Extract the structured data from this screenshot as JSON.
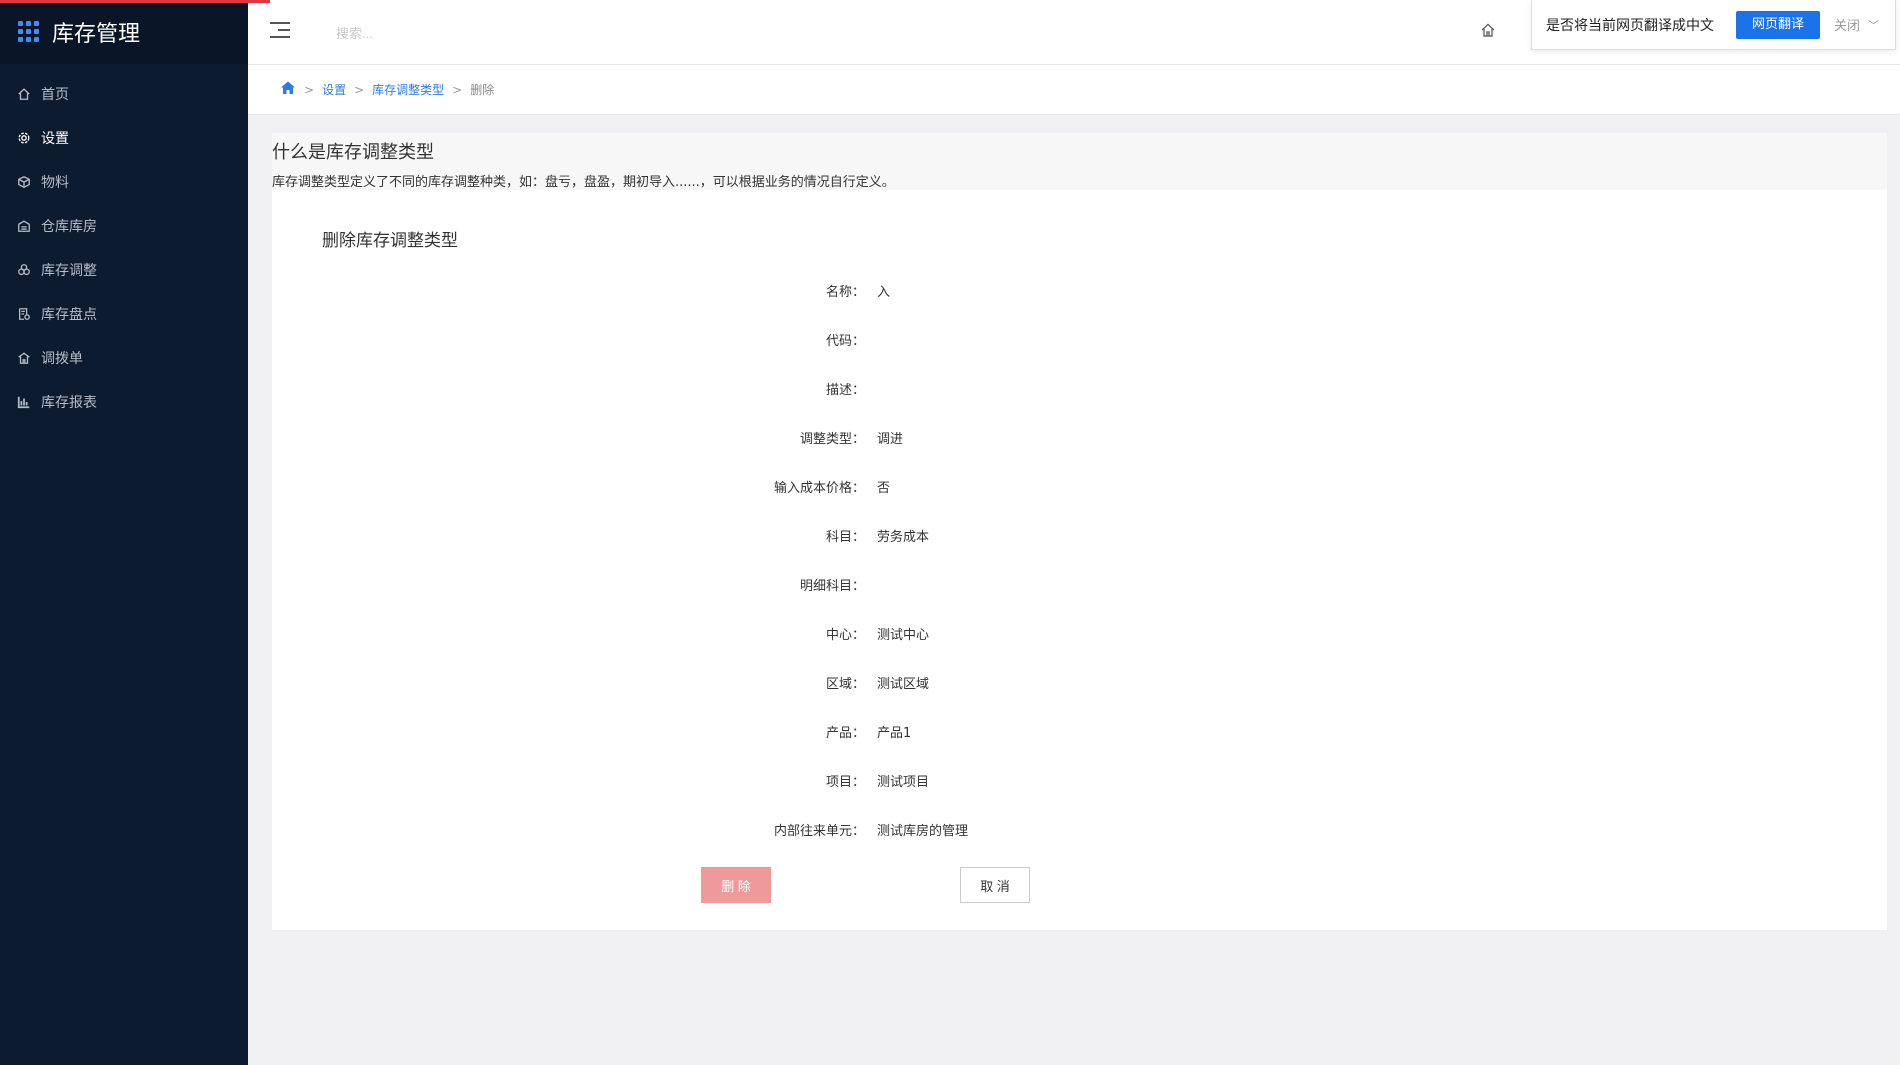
{
  "app": {
    "title": "库存管理",
    "accent_color": "#e0383e",
    "sidebar_bg": "#0d1b2f",
    "link_color": "#2d7be5"
  },
  "sidebar": {
    "items": [
      {
        "label": "首页",
        "icon": "home-icon"
      },
      {
        "label": "设置",
        "icon": "gear-icon"
      },
      {
        "label": "物料",
        "icon": "box-icon"
      },
      {
        "label": "仓库库房",
        "icon": "warehouse-icon"
      },
      {
        "label": "库存调整",
        "icon": "adjust-icon"
      },
      {
        "label": "库存盘点",
        "icon": "inventory-check-icon"
      },
      {
        "label": "调拨单",
        "icon": "transfer-icon"
      },
      {
        "label": "库存报表",
        "icon": "bar-chart-icon"
      }
    ]
  },
  "topbar": {
    "search_placeholder": "搜索..."
  },
  "translate_bar": {
    "question": "是否将当前网页翻译成中文",
    "translate_label": "网页翻译",
    "close_label": "关闭"
  },
  "breadcrumb": {
    "items": [
      "设置",
      "库存调整类型"
    ],
    "current": "删除",
    "sep": ">"
  },
  "intro": {
    "title": "什么是库存调整类型",
    "description": "库存调整类型定义了不同的库存调整种类，如：盘亏，盘盈，期初导入......，可以根据业务的情况自行定义。"
  },
  "form": {
    "title": "删除库存调整类型",
    "fields": [
      {
        "label": "名称：",
        "value": "入"
      },
      {
        "label": "代码：",
        "value": ""
      },
      {
        "label": "描述：",
        "value": ""
      },
      {
        "label": "调整类型：",
        "value": "调进"
      },
      {
        "label": "输入成本价格：",
        "value": "否"
      },
      {
        "label": "科目：",
        "value": "劳务成本"
      },
      {
        "label": "明细科目：",
        "value": ""
      },
      {
        "label": "中心：",
        "value": "测试中心"
      },
      {
        "label": "区域：",
        "value": "测试区域"
      },
      {
        "label": "产品：",
        "value": "产品1"
      },
      {
        "label": "项目：",
        "value": "测试项目"
      },
      {
        "label": "内部往来单元：",
        "value": "测试库房的管理"
      }
    ],
    "delete_label": "删 除",
    "cancel_label": "取 消"
  }
}
